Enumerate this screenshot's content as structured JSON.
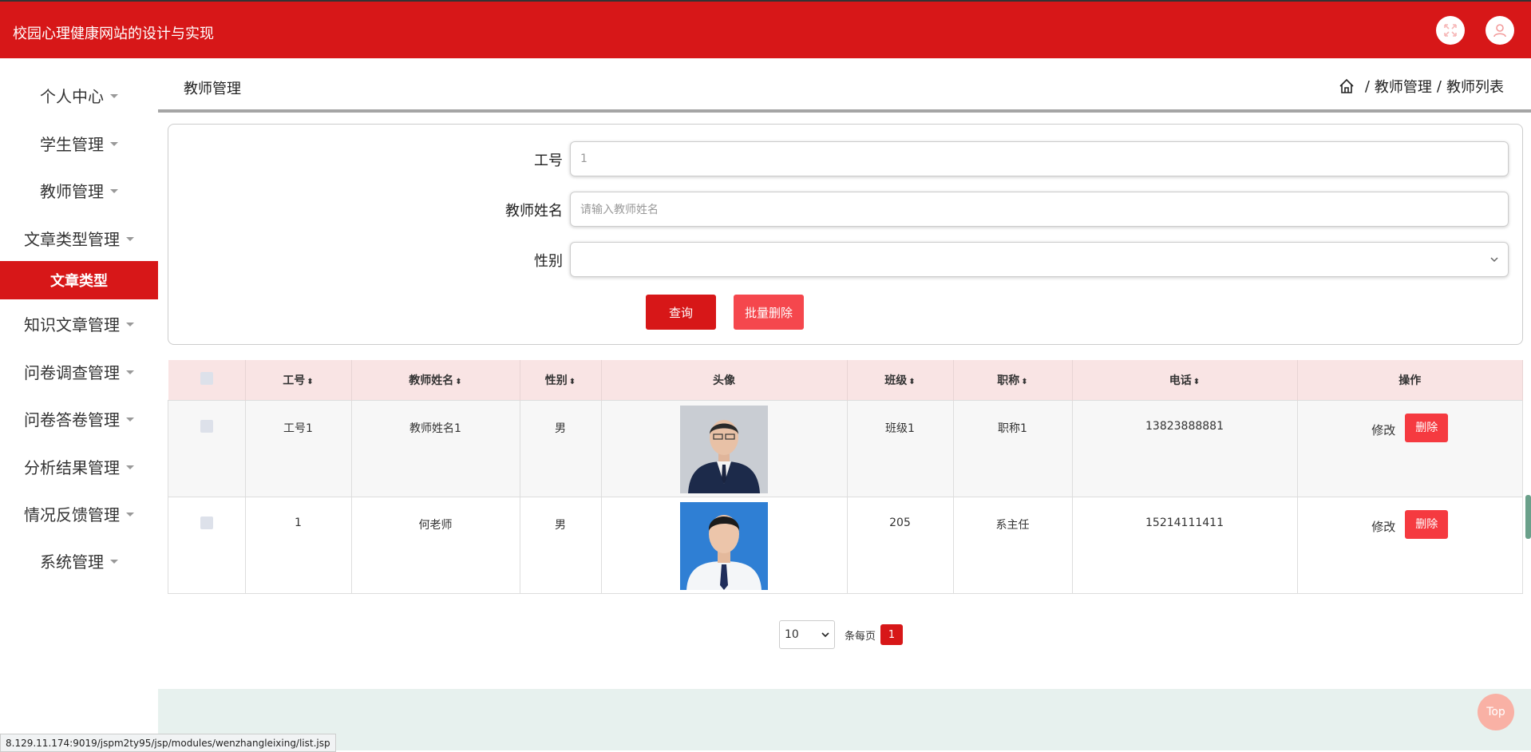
{
  "header": {
    "title": "校园心理健康网站的设计与实现"
  },
  "sidebar": {
    "items": [
      {
        "label": "个人中心"
      },
      {
        "label": "学生管理"
      },
      {
        "label": "教师管理"
      },
      {
        "label": "文章类型管理"
      },
      {
        "label": "知识文章管理"
      },
      {
        "label": "问卷调查管理"
      },
      {
        "label": "问卷答卷管理"
      },
      {
        "label": "分析结果管理"
      },
      {
        "label": "情况反馈管理"
      },
      {
        "label": "系统管理"
      }
    ],
    "active_sub": "文章类型"
  },
  "page": {
    "title": "教师管理",
    "breadcrumb": [
      "教师管理",
      "教师列表"
    ],
    "breadcrumb_sep": "/"
  },
  "search": {
    "fields": [
      {
        "label": "工号",
        "value": "1"
      },
      {
        "label": "教师姓名",
        "placeholder": "请输入教师姓名"
      },
      {
        "label": "性别",
        "value": ""
      }
    ],
    "query_button": "查询",
    "batch_delete_button": "批量删除"
  },
  "table": {
    "headers": [
      "工号",
      "教师姓名",
      "性别",
      "头像",
      "班级",
      "职称",
      "电话",
      "操作"
    ],
    "rows": [
      {
        "id": "工号1",
        "name": "教师姓名1",
        "gender": "男",
        "class": "班级1",
        "title": "职称1",
        "phone": "13823888881"
      },
      {
        "id": "1",
        "name": "何老师",
        "gender": "男",
        "class": "205",
        "title": "系主任",
        "phone": "15214111411"
      }
    ],
    "edit_label": "修改",
    "delete_label": "删除"
  },
  "pagination": {
    "page_size": "10",
    "per_page_label": "条每页",
    "current_page": "1"
  },
  "top_button": "Top",
  "status_url": "8.129.11.174:9019/jspm2ty95/jsp/modules/wenzhangleixing/list.jsp",
  "colors": {
    "brand": "#d71718",
    "delete": "#f53a40",
    "batch": "#f5474d"
  }
}
